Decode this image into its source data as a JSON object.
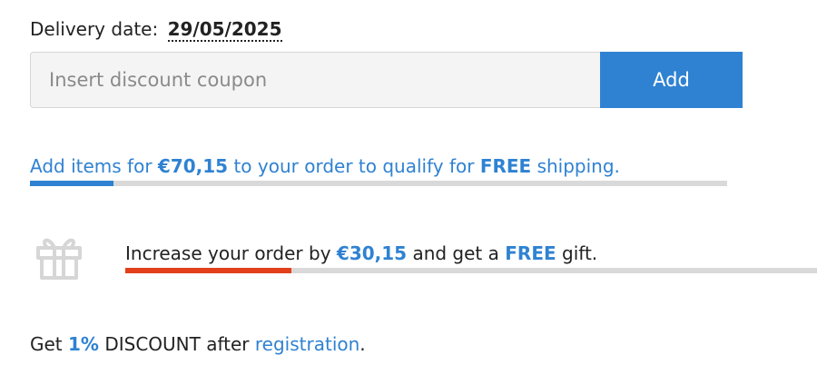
{
  "delivery": {
    "label": "Delivery date:",
    "date": "29/05/2025"
  },
  "coupon": {
    "placeholder": "Insert discount coupon",
    "button_label": "Add"
  },
  "free_shipping": {
    "prefix": "Add items for ",
    "amount": "€70,15",
    "middle": " to your order to qualify for ",
    "free": "FREE",
    "suffix": " shipping.",
    "progress": 0.12,
    "bar_color": "#2f82d2"
  },
  "free_gift": {
    "prefix": "Increase your order by ",
    "amount": "€30,15",
    "middle": " and get a ",
    "free": "FREE",
    "suffix": " gift.",
    "progress": 0.24,
    "bar_color": "#e2401b",
    "icon": "gift-icon"
  },
  "registration": {
    "prefix": "Get ",
    "percent": "1%",
    "middle": " DISCOUNT after ",
    "link": "registration",
    "suffix": "."
  },
  "colors": {
    "accent": "#2f82d2",
    "gift_bar": "#e2401b",
    "track": "#d9d9d9"
  }
}
